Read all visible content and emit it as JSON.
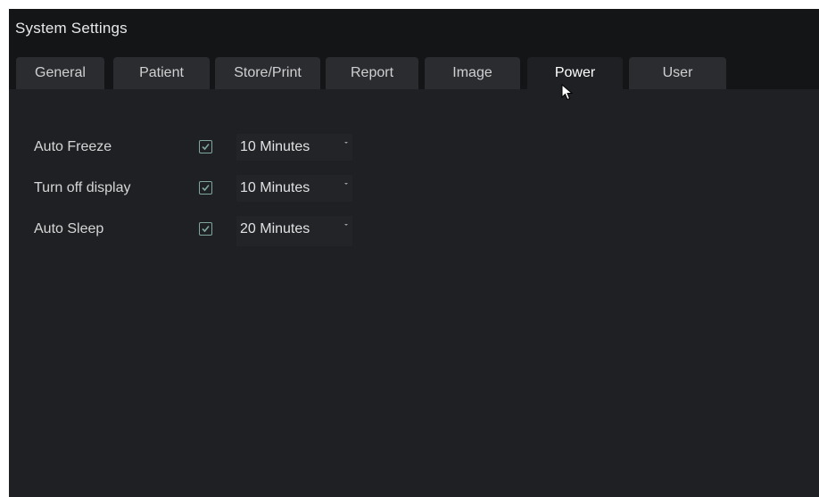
{
  "window": {
    "title": "System Settings"
  },
  "tabs": [
    {
      "label": "General"
    },
    {
      "label": "Patient"
    },
    {
      "label": "Store/Print"
    },
    {
      "label": "Report"
    },
    {
      "label": "Image"
    },
    {
      "label": "Power"
    },
    {
      "label": "User"
    }
  ],
  "active_tab": "Power",
  "power": {
    "rows": [
      {
        "label": "Auto Freeze",
        "checked": true,
        "value": "10 Minutes"
      },
      {
        "label": "Turn off display",
        "checked": true,
        "value": "10 Minutes"
      },
      {
        "label": "Auto Sleep",
        "checked": true,
        "value": "20 Minutes"
      }
    ]
  },
  "colors": {
    "background": "#1e2023",
    "title_bar": "#141517",
    "inactive_tab": "#2a2c30",
    "checkbox_accent": "#7fa79c",
    "text": "#d6d6d6"
  },
  "icons": {
    "checkbox": "checkmark-icon",
    "dropdown": "dropdown-arrow-icon",
    "cursor": "mouse-pointer-icon"
  }
}
